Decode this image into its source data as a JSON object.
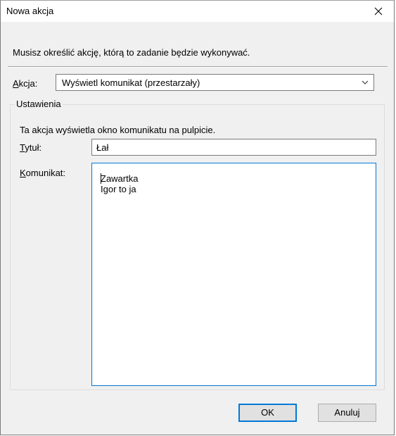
{
  "window": {
    "title": "Nowa akcja"
  },
  "intro_text": "Musisz określić akcję, którą to zadanie będzie wykonywać.",
  "action": {
    "label_accel": "A",
    "label_rest": "kcja:",
    "selected": "Wyświetl komunikat (przestarzały)"
  },
  "settings": {
    "legend": "Ustawienia",
    "description": "Ta akcja wyświetla okno komunikatu na pulpicie.",
    "title_label_accel": "T",
    "title_label_rest": "ytuł:",
    "title_value": "Łał",
    "message_label_accel": "K",
    "message_label_rest": "omunikat:",
    "message_value": "Zawartka Igor to ja"
  },
  "buttons": {
    "ok": "OK",
    "cancel": "Anuluj"
  }
}
